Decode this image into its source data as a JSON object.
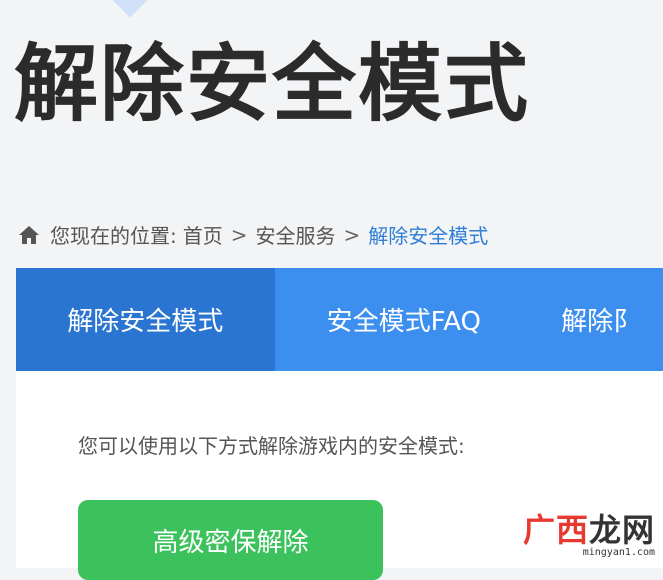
{
  "header": {
    "title": "解除安全模式"
  },
  "breadcrumb": {
    "icon": "home-icon",
    "prefix": "您现在的位置:",
    "items": [
      "首页",
      "安全服务",
      "解除安全模式"
    ],
    "separator": ">"
  },
  "tabs": [
    {
      "label": "解除安全模式",
      "active": true
    },
    {
      "label": "安全模式FAQ",
      "active": false
    },
    {
      "label": "解除阝",
      "active": false
    }
  ],
  "content": {
    "intro": "您可以使用以下方式解除游戏内的安全模式:",
    "primary_button": "高级密保解除"
  },
  "watermark": {
    "text_part1": "广西",
    "text_part2": "龙网",
    "url": "mingyan1.com"
  },
  "colors": {
    "tab_bar": "#3d8fef",
    "tab_active": "#2a74d2",
    "button_green": "#3cc25c",
    "breadcrumb_current": "#2f7fd8"
  }
}
